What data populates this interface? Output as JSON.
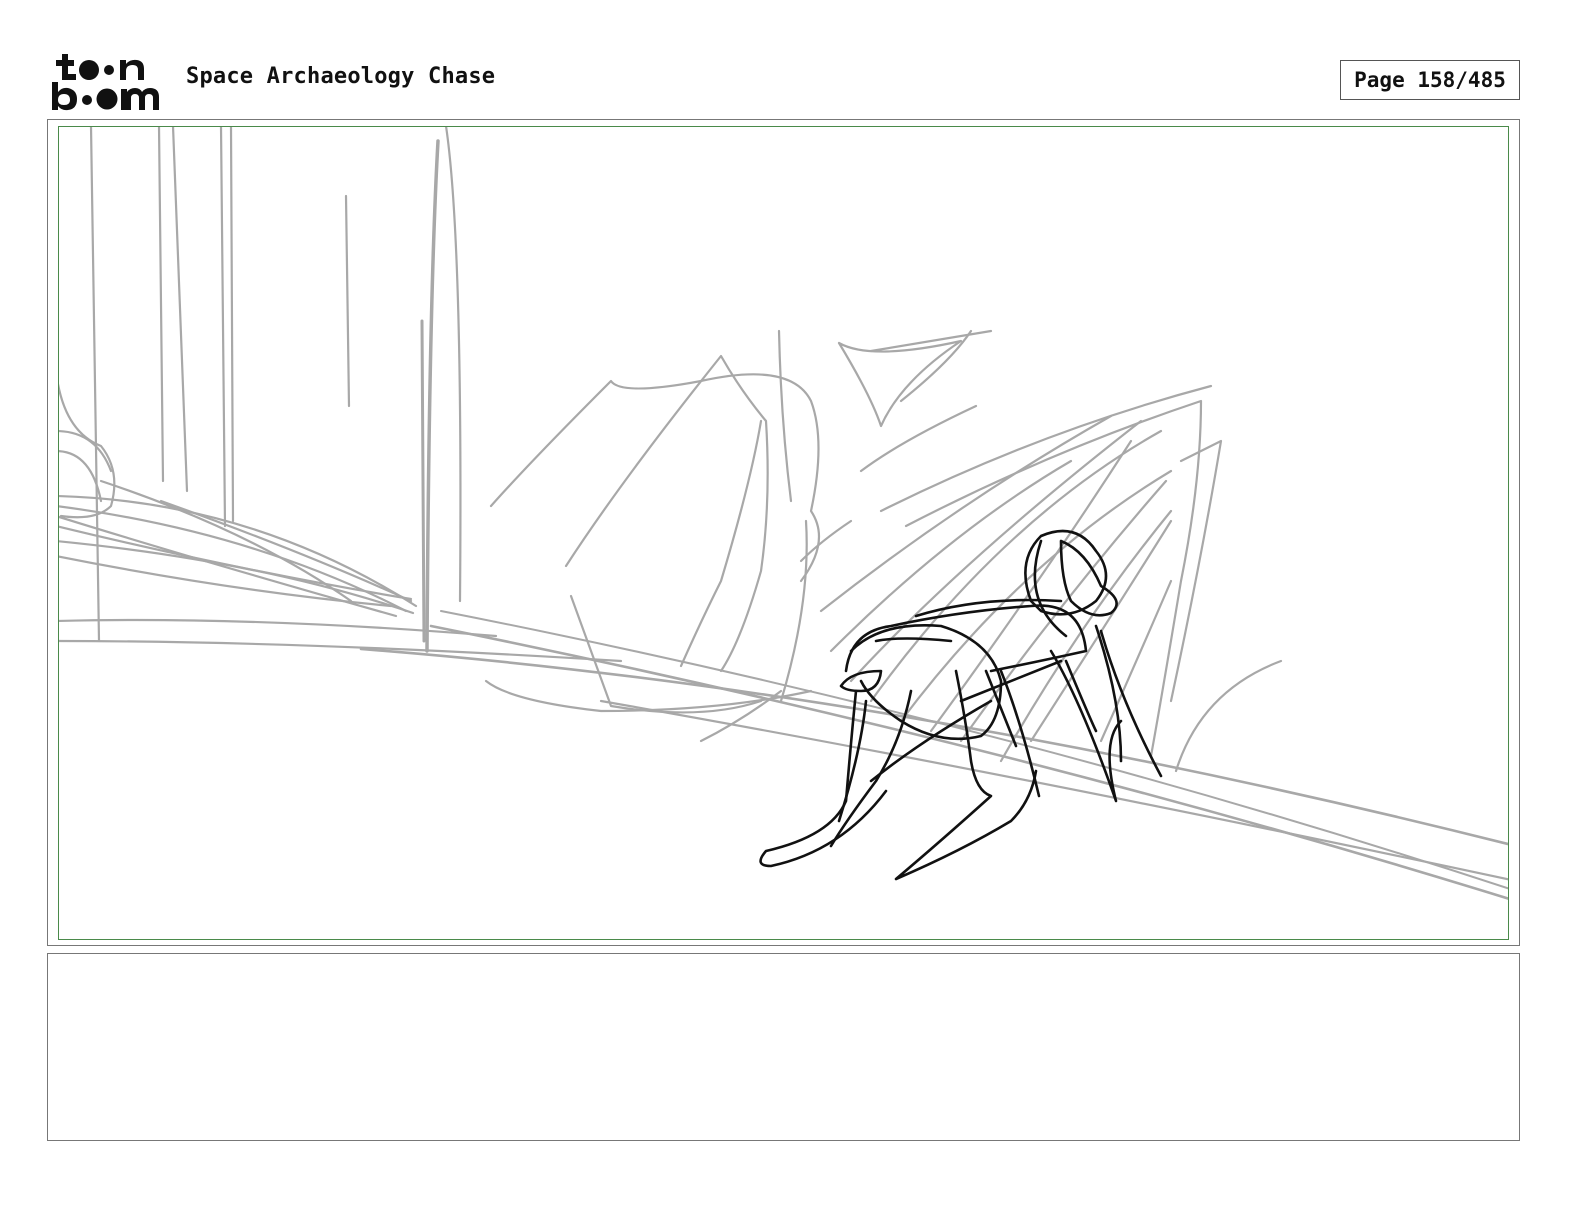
{
  "header": {
    "logo_text_top": "toon",
    "logo_text_bottom": "boom",
    "title": "Space Archaeology Chase",
    "page_label": "Page 158/485"
  },
  "panel": {
    "sketch_colors": {
      "background_lines": "#a8a8a8",
      "character_lines": "#111111",
      "safe_frame": "#4a8a4a"
    }
  },
  "notes": {
    "text": ""
  }
}
